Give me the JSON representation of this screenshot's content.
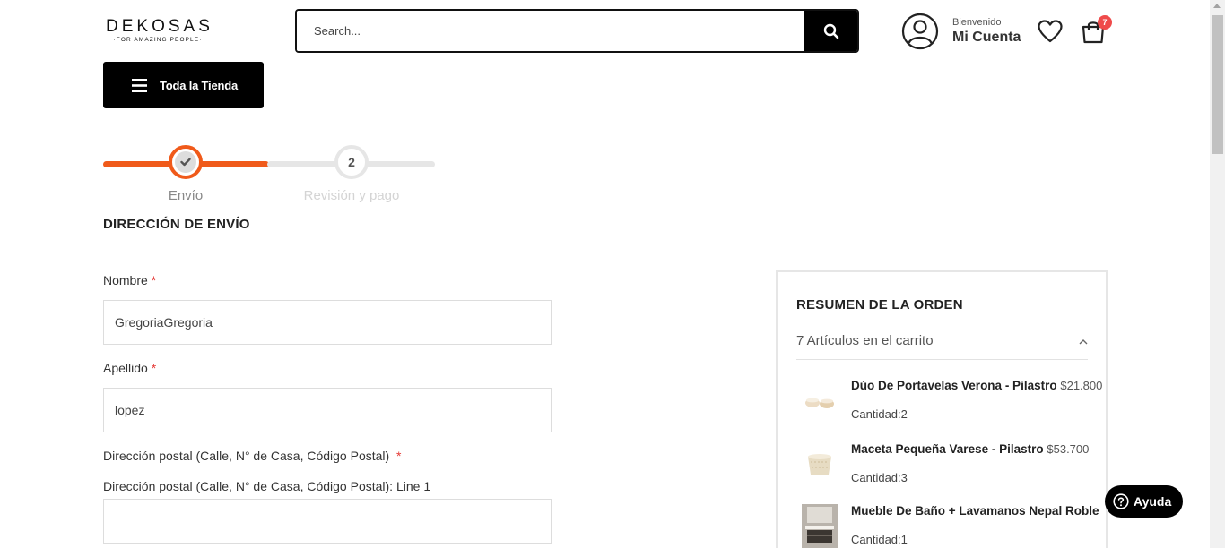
{
  "header": {
    "logo": {
      "word": "DEKOSAS",
      "tagline": "·FOR AMAZING PEOPLE·"
    },
    "search": {
      "placeholder": "Search...",
      "icon": "search-icon"
    },
    "account": {
      "welcome": "Bienvenido",
      "name": "Mi Cuenta",
      "icon": "user-icon"
    },
    "wishlist_icon": "heart-icon",
    "cart": {
      "icon": "shopping-bag-icon",
      "count": "7"
    }
  },
  "nav": {
    "store_button": "Toda la Tienda",
    "icon": "menu-icon"
  },
  "stepper": {
    "steps": [
      {
        "label": "Envío",
        "state": "done",
        "icon": "check-icon"
      },
      {
        "label": "Revisión y pago",
        "number": "2",
        "state": "pending"
      }
    ],
    "accent": "#f05a1a"
  },
  "shipping": {
    "title": "DIRECCIÓN DE ENVÍO",
    "fields": [
      {
        "label": "Nombre",
        "required": "*",
        "value": "GregoriaGregoria"
      },
      {
        "label": "Apellido",
        "required": "*",
        "value": "lopez"
      },
      {
        "label": "Dirección postal (Calle, N° de Casa, Código Postal)",
        "required": "*",
        "sublabel": "Dirección postal (Calle, N° de Casa, Código Postal): Line 1",
        "value": ""
      }
    ]
  },
  "summary": {
    "title": "RESUMEN DE LA ORDEN",
    "count_text": "7 Artículos en el carrito",
    "items": [
      {
        "name": "Dúo De Portavelas Verona - Pilastro",
        "price": "$21.800",
        "qty_label": "Cantidad:",
        "qty": "2"
      },
      {
        "name": "Maceta Pequeña Varese - Pilastro",
        "price": "$53.700",
        "qty_label": "Cantidad:",
        "qty": "3"
      },
      {
        "name": "Mueble De Baño + Lavamanos Nepal Roble",
        "price": "",
        "qty_label": "Cantidad:",
        "qty": "1"
      }
    ]
  },
  "help": {
    "label": "Ayuda",
    "icon": "question-icon"
  }
}
